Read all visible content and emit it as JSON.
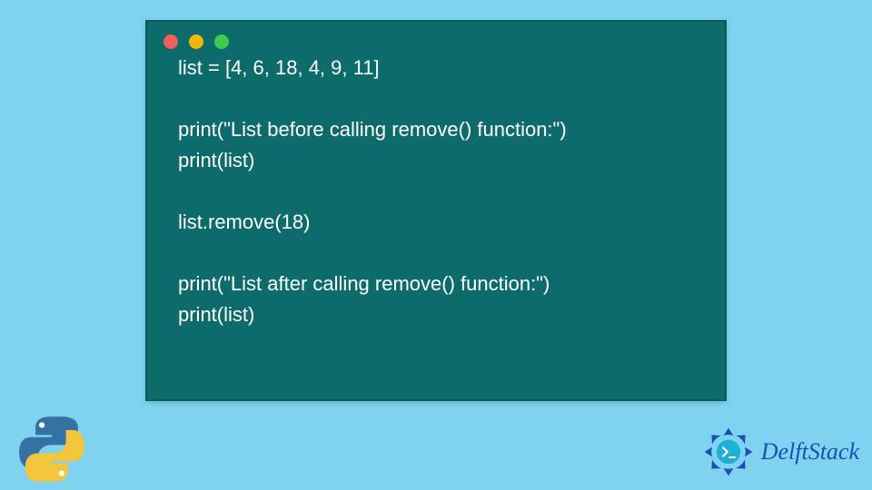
{
  "window": {
    "dots": {
      "red": "#f25f57",
      "yellow": "#f2b705",
      "green": "#3ecb4e"
    }
  },
  "code": {
    "lines": [
      "list = [4, 6, 18, 4, 9, 11]",
      "",
      "print(\"List before calling remove() function:\")",
      "print(list)",
      "",
      "list.remove(18)",
      "",
      "print(\"List after calling remove() function:\")",
      "print(list)"
    ]
  },
  "brand": {
    "name": "DelftStack",
    "color": "#1a4fb3"
  }
}
